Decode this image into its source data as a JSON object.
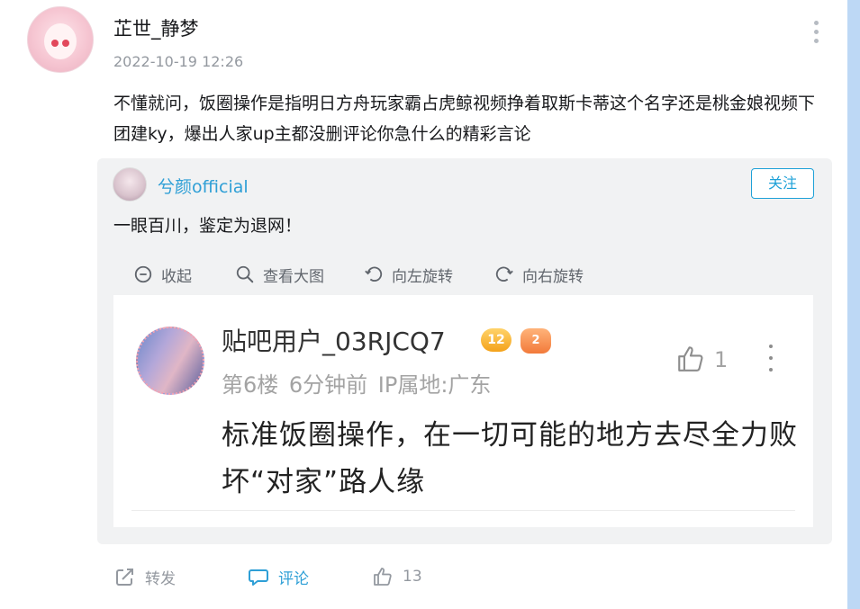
{
  "comment": {
    "user": "芷世_静梦",
    "timestamp": "2022-10-19 12:26",
    "text": "不懂就问，饭圈操作是指明日方舟玩家霸占虎鲸视频挣着取斯卡蒂这个名字还是桃金娘视频下团建ky，爆出人家up主都没删评论你急什么的精彩言论"
  },
  "card": {
    "user": "兮颜official",
    "follow_label": "关注",
    "text": "一眼百川，鉴定为退网！",
    "toolbar": {
      "collapse": "收起",
      "view_large": "查看大图",
      "rotate_left": "向左旋转",
      "rotate_right": "向右旋转"
    },
    "image": {
      "user": "贴吧用户_03RJCQ7",
      "level_badge": "12",
      "game_badge": "2",
      "meta": "第6楼 6分钟前 IP属地:广东",
      "like_count": "1",
      "text": "标准饭圈操作，在一切可能的地方去尽全力败坏“对家”路人缘"
    }
  },
  "actions": {
    "share": "转发",
    "comment": "评论",
    "like_count": "13"
  },
  "colors": {
    "accent": "#2e9fd6",
    "card_bg": "#f1f2f3",
    "muted": "#9499a0",
    "scrollbar": "#bdd8f5"
  }
}
